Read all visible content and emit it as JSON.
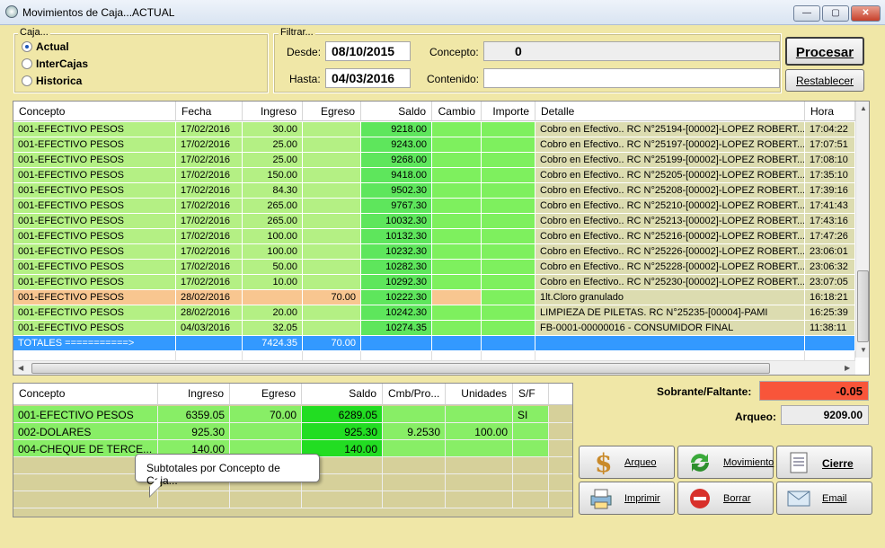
{
  "window": {
    "title": "Movimientos de Caja...ACTUAL"
  },
  "caja": {
    "label": "Caja...",
    "options": [
      {
        "label": "Actual",
        "selected": true
      },
      {
        "label": "InterCajas",
        "selected": false
      },
      {
        "label": "Historica",
        "selected": false
      }
    ]
  },
  "filtrar": {
    "label": "Filtrar...",
    "desde_label": "Desde:",
    "desde": "08/10/2015",
    "hasta_label": "Hasta:",
    "hasta": "04/03/2016",
    "concepto_label": "Concepto:",
    "concepto": "0",
    "contenido_label": "Contenido:",
    "contenido": ""
  },
  "buttons": {
    "procesar": "Procesar",
    "restablecer": "Restablecer"
  },
  "movements": {
    "columns": [
      "Concepto",
      "Fecha",
      "Ingreso",
      "Egreso",
      "Saldo",
      "Cambio",
      "Importe",
      "Detalle",
      "Hora"
    ],
    "rows": [
      {
        "concepto": "001-EFECTIVO PESOS",
        "fecha": "17/02/2016",
        "ingreso": "30.00",
        "egreso": "",
        "saldo": "9218.00",
        "detalle": "Cobro en Efectivo.. RC N°25194-[00002]-LOPEZ ROBERT...",
        "hora": "17:04:22",
        "type": "in"
      },
      {
        "concepto": "001-EFECTIVO PESOS",
        "fecha": "17/02/2016",
        "ingreso": "25.00",
        "egreso": "",
        "saldo": "9243.00",
        "detalle": "Cobro en Efectivo.. RC N°25197-[00002]-LOPEZ ROBERT...",
        "hora": "17:07:51",
        "type": "in"
      },
      {
        "concepto": "001-EFECTIVO PESOS",
        "fecha": "17/02/2016",
        "ingreso": "25.00",
        "egreso": "",
        "saldo": "9268.00",
        "detalle": "Cobro en Efectivo.. RC N°25199-[00002]-LOPEZ ROBERT...",
        "hora": "17:08:10",
        "type": "in"
      },
      {
        "concepto": "001-EFECTIVO PESOS",
        "fecha": "17/02/2016",
        "ingreso": "150.00",
        "egreso": "",
        "saldo": "9418.00",
        "detalle": "Cobro en Efectivo.. RC N°25205-[00002]-LOPEZ ROBERT...",
        "hora": "17:35:10",
        "type": "in"
      },
      {
        "concepto": "001-EFECTIVO PESOS",
        "fecha": "17/02/2016",
        "ingreso": "84.30",
        "egreso": "",
        "saldo": "9502.30",
        "detalle": "Cobro en Efectivo.. RC N°25208-[00002]-LOPEZ ROBERT...",
        "hora": "17:39:16",
        "type": "in"
      },
      {
        "concepto": "001-EFECTIVO PESOS",
        "fecha": "17/02/2016",
        "ingreso": "265.00",
        "egreso": "",
        "saldo": "9767.30",
        "detalle": "Cobro en Efectivo.. RC N°25210-[00002]-LOPEZ ROBERT...",
        "hora": "17:41:43",
        "type": "in"
      },
      {
        "concepto": "001-EFECTIVO PESOS",
        "fecha": "17/02/2016",
        "ingreso": "265.00",
        "egreso": "",
        "saldo": "10032.30",
        "detalle": "Cobro en Efectivo.. RC N°25213-[00002]-LOPEZ ROBERT...",
        "hora": "17:43:16",
        "type": "in"
      },
      {
        "concepto": "001-EFECTIVO PESOS",
        "fecha": "17/02/2016",
        "ingreso": "100.00",
        "egreso": "",
        "saldo": "10132.30",
        "detalle": "Cobro en Efectivo.. RC N°25216-[00002]-LOPEZ ROBERT...",
        "hora": "17:47:26",
        "type": "in"
      },
      {
        "concepto": "001-EFECTIVO PESOS",
        "fecha": "17/02/2016",
        "ingreso": "100.00",
        "egreso": "",
        "saldo": "10232.30",
        "detalle": "Cobro en Efectivo.. RC N°25226-[00002]-LOPEZ ROBERT...",
        "hora": "23:06:01",
        "type": "in"
      },
      {
        "concepto": "001-EFECTIVO PESOS",
        "fecha": "17/02/2016",
        "ingreso": "50.00",
        "egreso": "",
        "saldo": "10282.30",
        "detalle": "Cobro en Efectivo.. RC N°25228-[00002]-LOPEZ ROBERT...",
        "hora": "23:06:32",
        "type": "in"
      },
      {
        "concepto": "001-EFECTIVO PESOS",
        "fecha": "17/02/2016",
        "ingreso": "10.00",
        "egreso": "",
        "saldo": "10292.30",
        "detalle": "Cobro en Efectivo.. RC N°25230-[00002]-LOPEZ ROBERT...",
        "hora": "23:07:05",
        "type": "in"
      },
      {
        "concepto": "001-EFECTIVO PESOS",
        "fecha": "28/02/2016",
        "ingreso": "",
        "egreso": "70.00",
        "saldo": "10222.30",
        "detalle": "1lt.Cloro granulado",
        "hora": "16:18:21",
        "type": "out"
      },
      {
        "concepto": "001-EFECTIVO PESOS",
        "fecha": "28/02/2016",
        "ingreso": "20.00",
        "egreso": "",
        "saldo": "10242.30",
        "detalle": "LIMPIEZA DE PILETAS. RC N°25235-[00004]-PAMI",
        "hora": "16:25:39",
        "type": "in"
      },
      {
        "concepto": "001-EFECTIVO PESOS",
        "fecha": "04/03/2016",
        "ingreso": "32.05",
        "egreso": "",
        "saldo": "10274.35",
        "detalle": "FB-0001-00000016 - CONSUMIDOR FINAL",
        "hora": "11:38:11",
        "type": "in"
      }
    ],
    "totals": {
      "label": "TOTALES ===========>",
      "ingreso": "7424.35",
      "egreso": "70.00"
    }
  },
  "subtotals": {
    "columns": [
      "Concepto",
      "Ingreso",
      "Egreso",
      "Saldo",
      "Cmb/Pro...",
      "Unidades",
      "S/F"
    ],
    "rows": [
      {
        "concepto": "001-EFECTIVO PESOS",
        "ingreso": "6359.05",
        "egreso": "70.00",
        "saldo": "6289.05",
        "cmb": "",
        "unidades": "",
        "sf": "SI"
      },
      {
        "concepto": "002-DOLARES",
        "ingreso": "925.30",
        "egreso": "",
        "saldo": "925.30",
        "cmb": "9.2530",
        "unidades": "100.00",
        "sf": ""
      },
      {
        "concepto": "004-CHEQUE DE TERCE...",
        "ingreso": "140.00",
        "egreso": "",
        "saldo": "140.00",
        "cmb": "",
        "unidades": "",
        "sf": ""
      }
    ]
  },
  "tooltip": "Subtotales por Concepto de Caja...",
  "summary": {
    "sobrante_label": "Sobrante/Faltante:",
    "sobrante": "-0.05",
    "arqueo_label": "Arqueo:",
    "arqueo": "9209.00"
  },
  "actions": {
    "arqueo": "Arqueo",
    "movimiento": "Movimiento",
    "cierre": "Cierre",
    "imprimir": "Imprimir",
    "borrar": "Borrar",
    "email": "Email"
  }
}
